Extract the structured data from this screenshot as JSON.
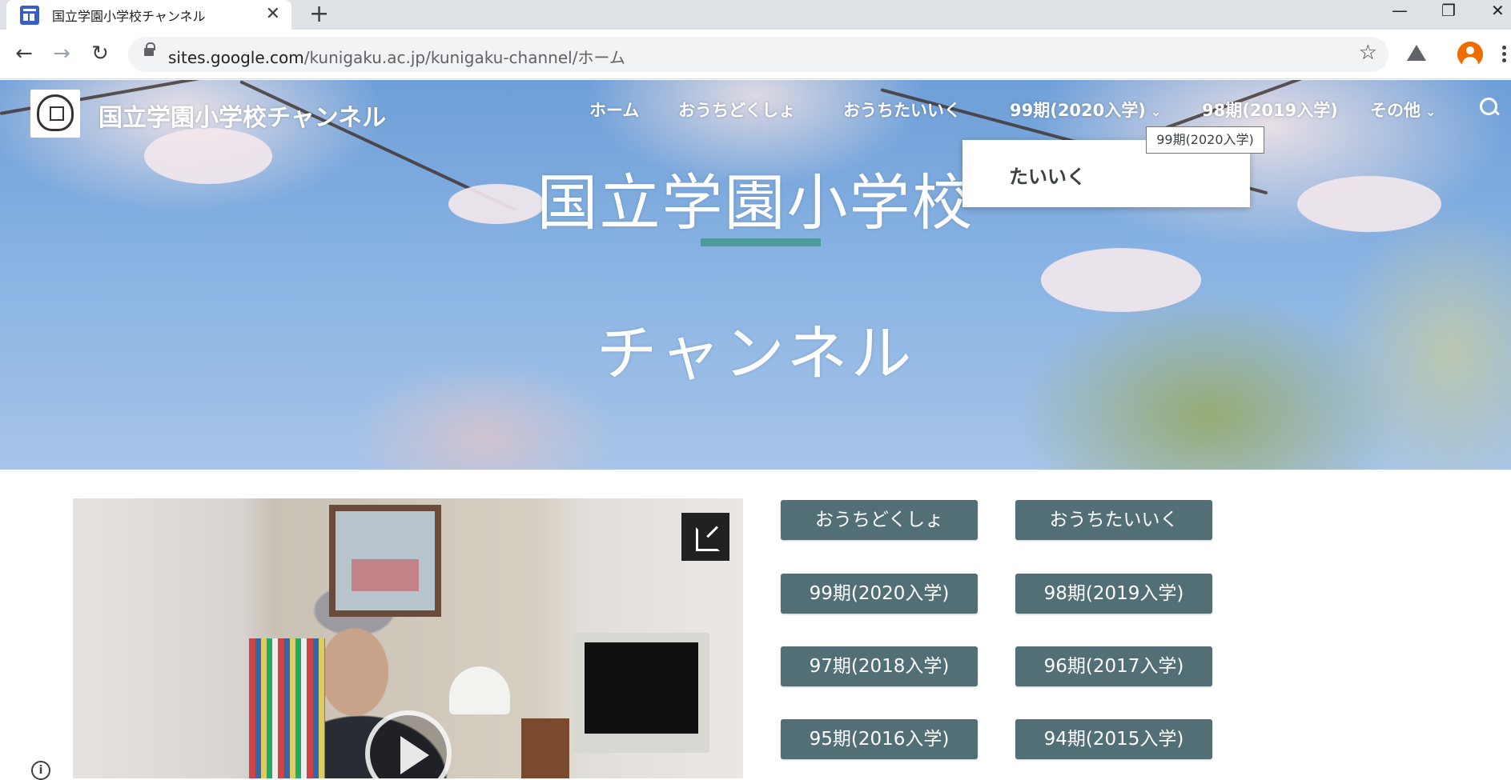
{
  "browser": {
    "tab_title": "国立学園小学校チャンネル",
    "tab_close": "✕",
    "new_tab": "+",
    "window_controls": {
      "minimize": "—",
      "maximize": "❐",
      "close": "✕"
    },
    "back": "←",
    "forward": "→",
    "reload": "↻",
    "url_host": "sites.google.com",
    "url_path": "/kunigaku.ac.jp/kunigaku-channel/ホーム",
    "bookmark_star": "☆"
  },
  "site": {
    "title": "国立学園小学校チャンネル",
    "nav": {
      "home": "ホーム",
      "reading": "おうちどくしょ",
      "pe": "おうちたいいく",
      "term99": "99期(2020入学)",
      "term98": "98期(2019入学)",
      "other": "その他",
      "chevron": "⌄"
    },
    "dropdown_item": "たいいく",
    "tooltip": "99期(2020入学)"
  },
  "hero": {
    "title_line1": "国立学園小学校",
    "title_line2": "チャンネル",
    "accent_color": "#4d9a9c"
  },
  "buttons": [
    "おうちどくしょ",
    "おうちたいいく",
    "99期(2020入学)",
    "98期(2019入学)",
    "97期(2018入学)",
    "96期(2017入学)",
    "95期(2016入学)",
    "94期(2015入学)"
  ],
  "button_color": "#516f74",
  "icons": {
    "popout": "open-in-new-icon",
    "play": "play-icon",
    "info": "i"
  }
}
